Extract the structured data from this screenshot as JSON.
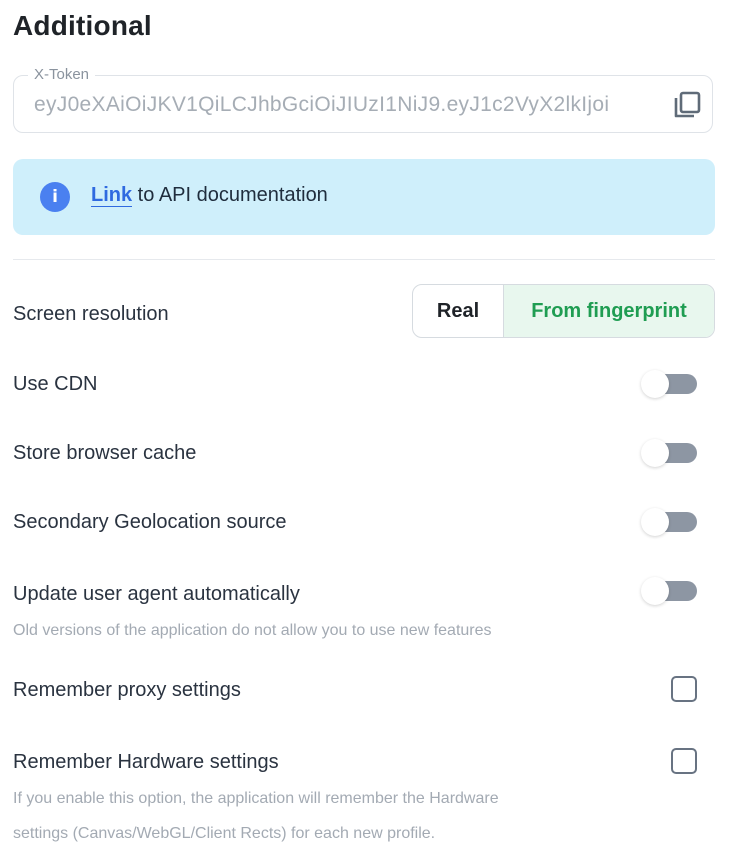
{
  "section": {
    "title": "Additional"
  },
  "token": {
    "label": "X-Token",
    "value": "eyJ0eXAiOiJKV1QiLCJhbGciOiJIUzI1NiJ9.eyJ1c2VyX2lkIjoi",
    "copy_icon": "copy-icon"
  },
  "info": {
    "icon": "info-icon",
    "icon_glyph": "i",
    "link_text": "Link",
    "text": " to API documentation",
    "accent": "#4a80f0",
    "background": "#cfeffb"
  },
  "screen_resolution": {
    "label": "Screen resolution",
    "options": [
      "Real",
      "From fingerprint"
    ],
    "selected": "From fingerprint",
    "selected_color": "#1f9d52"
  },
  "settings": {
    "use_cdn": {
      "label": "Use CDN",
      "enabled": false
    },
    "store_cache": {
      "label": "Store browser cache",
      "enabled": false
    },
    "secondary_geo": {
      "label": "Secondary Geolocation source",
      "enabled": false
    },
    "update_ua": {
      "label": "Update user agent automatically",
      "hint": "Old versions of the application do not allow you to use new features",
      "enabled": false
    },
    "remember_proxy": {
      "label": "Remember proxy settings",
      "checked": false
    },
    "remember_hardware": {
      "label": "Remember Hardware settings",
      "hint_line1": "If you enable this option, the application will remember the Hardware",
      "hint_line2": "settings (Canvas/WebGL/Client Rects) for each new profile.",
      "checked": false
    }
  }
}
